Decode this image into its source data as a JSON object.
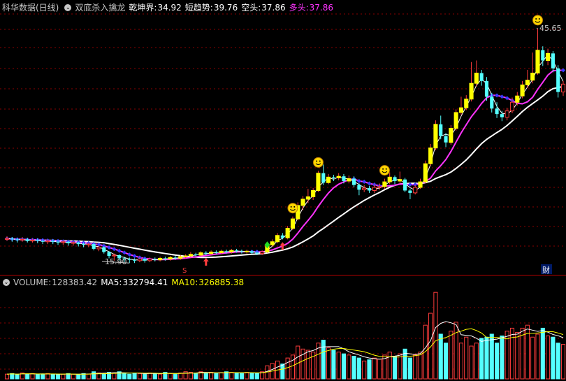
{
  "header": {
    "stock_title": "科华数据(日线)",
    "indicator_name": "双底杀入擒龙",
    "qiankun_label": "乾坤界:",
    "qiankun_value": "34.92",
    "short_trend_label": "短趋势:",
    "short_trend_value": "39.76",
    "short_label": "空头:",
    "short_value": "37.86",
    "long_label": "多头:",
    "long_value": "37.86"
  },
  "volume_header": {
    "label": "VOLUME:",
    "value": "128383.42",
    "ma5_label": "MA5:",
    "ma5_value": "332794.41",
    "ma10_label": "MA10:",
    "ma10_value": "326885.38"
  },
  "annotations": {
    "high_label": "45.65",
    "low_label": "15.90",
    "cai_marker": "财",
    "s_marker": "S"
  },
  "colors": {
    "up": "#ff3c3c",
    "down": "#54ffff",
    "signal": "#ffff00",
    "white_line": "#ffffff",
    "magenta_line": "#ff33ff",
    "blue_marker": "#3a3aff",
    "grid": "#8b0000"
  },
  "chart_data": {
    "type": "candlestick",
    "price_range": [
      14.5,
      47.5
    ],
    "candles": [
      {
        "o": 18.9,
        "c": 19.0,
        "h": 19.3,
        "l": 18.7
      },
      {
        "o": 19.0,
        "c": 18.9,
        "h": 19.2,
        "l": 18.6
      },
      {
        "o": 18.9,
        "c": 18.8,
        "h": 19.1,
        "l": 18.5
      },
      {
        "o": 18.8,
        "c": 18.9,
        "h": 19.2,
        "l": 18.6
      },
      {
        "o": 18.9,
        "c": 18.7,
        "h": 19.1,
        "l": 18.5
      },
      {
        "o": 18.7,
        "c": 18.8,
        "h": 19.0,
        "l": 18.5
      },
      {
        "o": 18.8,
        "c": 18.7,
        "h": 19.0,
        "l": 18.4
      },
      {
        "o": 18.7,
        "c": 18.6,
        "h": 18.9,
        "l": 18.3
      },
      {
        "o": 18.6,
        "c": 18.7,
        "h": 18.9,
        "l": 18.3
      },
      {
        "o": 18.7,
        "c": 18.6,
        "h": 18.9,
        "l": 18.3
      },
      {
        "o": 18.6,
        "c": 18.5,
        "h": 18.8,
        "l": 18.2
      },
      {
        "o": 18.5,
        "c": 18.6,
        "h": 18.8,
        "l": 18.2
      },
      {
        "o": 18.6,
        "c": 18.4,
        "h": 18.7,
        "l": 18.1
      },
      {
        "o": 18.4,
        "c": 18.5,
        "h": 18.7,
        "l": 18.1
      },
      {
        "o": 18.5,
        "c": 18.3,
        "h": 18.6,
        "l": 18.0
      },
      {
        "o": 18.3,
        "c": 18.2,
        "h": 18.5,
        "l": 17.9
      },
      {
        "o": 18.2,
        "c": 18.3,
        "h": 18.5,
        "l": 17.9
      },
      {
        "o": 18.3,
        "c": 17.7,
        "h": 18.4,
        "l": 17.5
      },
      {
        "o": 17.7,
        "c": 17.9,
        "h": 18.1,
        "l": 17.4
      },
      {
        "o": 17.9,
        "c": 17.3,
        "h": 18.0,
        "l": 17.1
      },
      {
        "o": 17.3,
        "c": 16.8,
        "h": 17.4,
        "l": 16.5
      },
      {
        "o": 16.8,
        "c": 16.9,
        "h": 17.1,
        "l": 16.2
      },
      {
        "o": 16.9,
        "c": 16.5,
        "h": 17.0,
        "l": 16.2
      },
      {
        "o": 16.5,
        "c": 16.4,
        "h": 16.7,
        "l": 16.0
      },
      {
        "o": 16.4,
        "c": 16.3,
        "h": 16.6,
        "l": 15.9
      },
      {
        "o": 16.3,
        "c": 16.2,
        "h": 16.5,
        "l": 15.9
      },
      {
        "o": 16.2,
        "c": 16.4,
        "h": 16.6,
        "l": 16.0
      },
      {
        "o": 16.4,
        "c": 16.2,
        "h": 16.5,
        "l": 15.95
      },
      {
        "o": 16.2,
        "c": 16.4,
        "h": 16.6,
        "l": 16.0
      },
      {
        "o": 16.4,
        "c": 16.3,
        "h": 16.6,
        "l": 16.1
      },
      {
        "o": 16.3,
        "c": 16.5,
        "h": 16.7,
        "l": 16.1
      },
      {
        "o": 16.5,
        "c": 16.4,
        "h": 16.7,
        "l": 16.2
      },
      {
        "o": 16.4,
        "c": 16.6,
        "h": 16.8,
        "l": 16.2
      },
      {
        "o": 16.6,
        "c": 16.5,
        "h": 16.8,
        "l": 16.3
      },
      {
        "o": 16.5,
        "c": 16.7,
        "h": 16.9,
        "l": 16.3
      },
      {
        "o": 16.7,
        "c": 16.8,
        "h": 17.0,
        "l": 16.5
      },
      {
        "o": 16.8,
        "c": 17.0,
        "h": 17.3,
        "l": 16.6
      },
      {
        "o": 17.0,
        "c": 16.9,
        "h": 17.2,
        "l": 16.7
      },
      {
        "o": 16.9,
        "c": 17.2,
        "h": 17.4,
        "l": 16.7
      },
      {
        "o": 17.2,
        "c": 17.1,
        "h": 17.4,
        "l": 16.9
      },
      {
        "o": 17.1,
        "c": 17.3,
        "h": 17.5,
        "l": 16.9
      },
      {
        "o": 17.3,
        "c": 17.2,
        "h": 17.5,
        "l": 17.0
      },
      {
        "o": 17.2,
        "c": 17.4,
        "h": 17.6,
        "l": 17.0
      },
      {
        "o": 17.4,
        "c": 17.3,
        "h": 17.6,
        "l": 17.1
      },
      {
        "o": 17.3,
        "c": 17.5,
        "h": 17.7,
        "l": 17.1
      },
      {
        "o": 17.5,
        "c": 17.4,
        "h": 17.7,
        "l": 17.2
      },
      {
        "o": 17.4,
        "c": 17.3,
        "h": 17.6,
        "l": 17.1
      },
      {
        "o": 17.3,
        "c": 17.4,
        "h": 17.6,
        "l": 17.1
      },
      {
        "o": 17.4,
        "c": 17.2,
        "h": 17.5,
        "l": 17.0
      },
      {
        "o": 17.2,
        "c": 17.1,
        "h": 17.4,
        "l": 16.9
      },
      {
        "o": 17.1,
        "c": 17.3,
        "h": 17.5,
        "l": 16.9
      },
      {
        "o": 17.3,
        "c": 18.2,
        "h": 18.4,
        "l": 17.2
      },
      {
        "o": 18.2,
        "c": 18.6,
        "h": 18.9,
        "l": 18.0
      },
      {
        "o": 18.6,
        "c": 19.4,
        "h": 19.7,
        "l": 18.4
      },
      {
        "o": 19.4,
        "c": 19.1,
        "h": 19.7,
        "l": 18.9
      },
      {
        "o": 19.1,
        "c": 20.3,
        "h": 20.6,
        "l": 18.9
      },
      {
        "o": 20.3,
        "c": 21.5,
        "h": 21.8,
        "l": 20.1
      },
      {
        "o": 21.5,
        "c": 23.2,
        "h": 23.6,
        "l": 21.3
      },
      {
        "o": 23.2,
        "c": 24.0,
        "h": 24.4,
        "l": 22.6
      },
      {
        "o": 24.0,
        "c": 24.3,
        "h": 25.3,
        "l": 23.5
      },
      {
        "o": 24.3,
        "c": 25.1,
        "h": 25.4,
        "l": 23.9
      },
      {
        "o": 25.1,
        "c": 27.3,
        "h": 27.6,
        "l": 24.9
      },
      {
        "o": 27.3,
        "c": 26.1,
        "h": 28.4,
        "l": 25.8
      },
      {
        "o": 26.1,
        "c": 26.8,
        "h": 27.2,
        "l": 25.9
      },
      {
        "o": 26.8,
        "c": 26.7,
        "h": 27.1,
        "l": 26.3
      },
      {
        "o": 26.7,
        "c": 26.9,
        "h": 27.3,
        "l": 26.4
      },
      {
        "o": 26.9,
        "c": 26.3,
        "h": 27.2,
        "l": 26.0
      },
      {
        "o": 26.3,
        "c": 26.6,
        "h": 27.0,
        "l": 26.0
      },
      {
        "o": 26.6,
        "c": 25.8,
        "h": 26.9,
        "l": 25.5
      },
      {
        "o": 25.8,
        "c": 25.2,
        "h": 26.0,
        "l": 24.5
      },
      {
        "o": 25.2,
        "c": 25.4,
        "h": 25.8,
        "l": 24.9
      },
      {
        "o": 25.4,
        "c": 25.1,
        "h": 25.7,
        "l": 24.8
      },
      {
        "o": 25.1,
        "c": 25.5,
        "h": 25.9,
        "l": 24.8
      },
      {
        "o": 25.5,
        "c": 25.6,
        "h": 26.0,
        "l": 25.2
      },
      {
        "o": 25.6,
        "c": 26.2,
        "h": 26.6,
        "l": 25.3
      },
      {
        "o": 26.2,
        "c": 26.8,
        "h": 27.4,
        "l": 25.9
      },
      {
        "o": 26.8,
        "c": 26.3,
        "h": 27.0,
        "l": 25.9
      },
      {
        "o": 26.3,
        "c": 26.5,
        "h": 27.5,
        "l": 26.0
      },
      {
        "o": 26.5,
        "c": 25.1,
        "h": 26.7,
        "l": 24.9
      },
      {
        "o": 25.1,
        "c": 24.8,
        "h": 25.3,
        "l": 24.0
      },
      {
        "o": 24.8,
        "c": 25.5,
        "h": 25.8,
        "l": 24.6
      },
      {
        "o": 25.5,
        "c": 26.2,
        "h": 26.6,
        "l": 25.3
      },
      {
        "o": 26.2,
        "c": 28.5,
        "h": 28.9,
        "l": 26.0
      },
      {
        "o": 28.5,
        "c": 30.5,
        "h": 31.0,
        "l": 28.2
      },
      {
        "o": 30.5,
        "c": 33.5,
        "h": 34.0,
        "l": 30.2
      },
      {
        "o": 33.5,
        "c": 32.0,
        "h": 34.6,
        "l": 31.6
      },
      {
        "o": 32.0,
        "c": 31.2,
        "h": 32.4,
        "l": 30.6
      },
      {
        "o": 31.2,
        "c": 33.0,
        "h": 33.4,
        "l": 30.9
      },
      {
        "o": 33.0,
        "c": 35.0,
        "h": 35.4,
        "l": 32.7
      },
      {
        "o": 35.0,
        "c": 35.6,
        "h": 37.0,
        "l": 34.7
      },
      {
        "o": 35.6,
        "c": 36.7,
        "h": 37.2,
        "l": 35.3
      },
      {
        "o": 36.7,
        "c": 38.7,
        "h": 41.4,
        "l": 36.4
      },
      {
        "o": 38.7,
        "c": 40.0,
        "h": 41.6,
        "l": 38.3
      },
      {
        "o": 40.0,
        "c": 39.0,
        "h": 40.4,
        "l": 38.4
      },
      {
        "o": 39.0,
        "c": 37.0,
        "h": 39.5,
        "l": 36.5
      },
      {
        "o": 37.0,
        "c": 35.5,
        "h": 37.5,
        "l": 35.0
      },
      {
        "o": 35.5,
        "c": 34.8,
        "h": 36.3,
        "l": 34.3
      },
      {
        "o": 34.8,
        "c": 34.4,
        "h": 35.2,
        "l": 33.9
      },
      {
        "o": 34.4,
        "c": 35.2,
        "h": 35.6,
        "l": 34.0
      },
      {
        "o": 35.2,
        "c": 36.3,
        "h": 36.9,
        "l": 34.9
      },
      {
        "o": 36.3,
        "c": 37.1,
        "h": 37.6,
        "l": 35.9
      },
      {
        "o": 37.1,
        "c": 38.5,
        "h": 39.0,
        "l": 36.8
      },
      {
        "o": 38.5,
        "c": 39.1,
        "h": 40.4,
        "l": 38.1
      },
      {
        "o": 39.1,
        "c": 40.0,
        "h": 42.6,
        "l": 38.7
      },
      {
        "o": 40.0,
        "c": 42.9,
        "h": 45.65,
        "l": 39.8
      },
      {
        "o": 42.9,
        "c": 41.6,
        "h": 43.4,
        "l": 40.9
      },
      {
        "o": 41.6,
        "c": 42.5,
        "h": 43.1,
        "l": 41.0
      },
      {
        "o": 42.5,
        "c": 40.6,
        "h": 42.8,
        "l": 40.1
      },
      {
        "o": 40.6,
        "c": 37.6,
        "h": 41.0,
        "l": 36.9
      },
      {
        "o": 37.6,
        "c": 38.6,
        "h": 39.0,
        "l": 37.1
      }
    ],
    "volumes": [
      8,
      9,
      7,
      10,
      8,
      9,
      7,
      8,
      9,
      8,
      7,
      8,
      9,
      8,
      7,
      9,
      8,
      12,
      10,
      9,
      11,
      10,
      12,
      9,
      8,
      10,
      9,
      8,
      10,
      9,
      8,
      11,
      9,
      8,
      10,
      12,
      11,
      9,
      12,
      10,
      11,
      9,
      10,
      12,
      11,
      10,
      9,
      11,
      10,
      9,
      12,
      22,
      26,
      30,
      25,
      35,
      40,
      55,
      50,
      48,
      45,
      60,
      65,
      52,
      48,
      45,
      42,
      40,
      38,
      35,
      30,
      32,
      35,
      33,
      40,
      45,
      38,
      42,
      50,
      35,
      40,
      45,
      90,
      110,
      145,
      75,
      60,
      80,
      95,
      60,
      70,
      55,
      60,
      68,
      70,
      75,
      60,
      72,
      80,
      85,
      78,
      85,
      90,
      70,
      75,
      85,
      72,
      70,
      60,
      58
    ],
    "signals": {
      "smiley_indices": [
        56,
        61,
        74,
        104
      ],
      "buy_arrow_indices": [
        39,
        54
      ],
      "green_diamond_index": 51
    }
  }
}
